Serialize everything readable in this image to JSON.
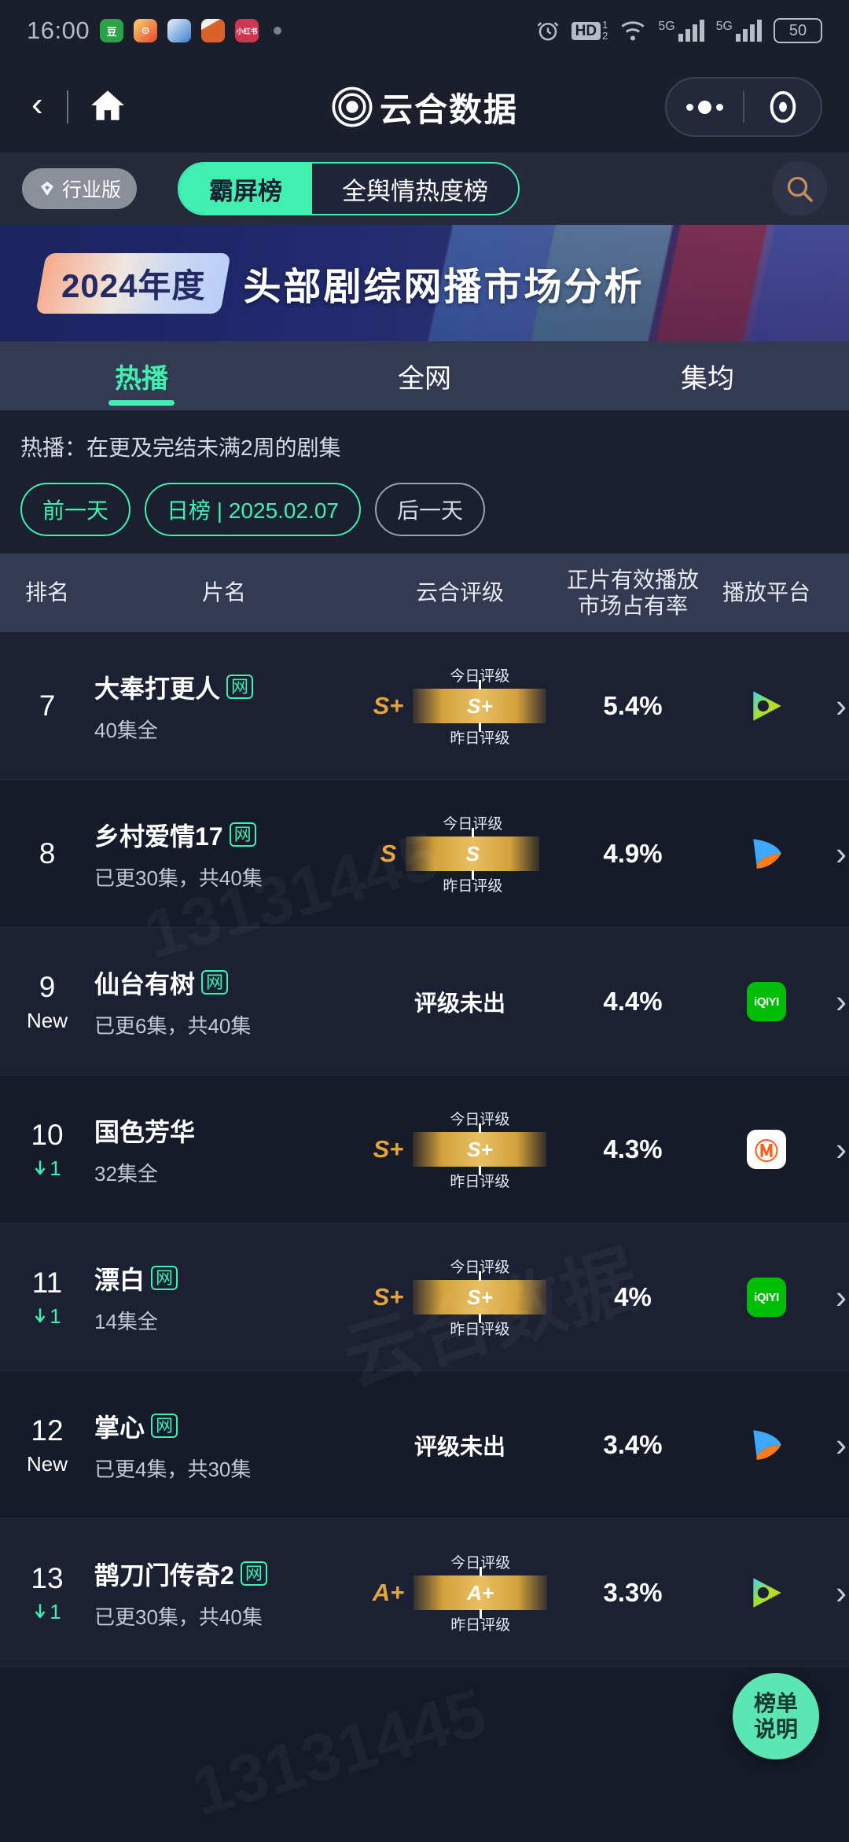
{
  "status_bar": {
    "time": "16:00",
    "app_icons": [
      "douban-icon",
      "weibo-icon",
      "browser-icon",
      "taobao-icon",
      "xiaohongshu-icon"
    ],
    "alarm_icon": "alarm-icon",
    "hd_label": "HD",
    "hd_sub_top": "1",
    "hd_sub_bottom": "2",
    "wifi_icon": "wifi-icon",
    "signal_1_label": "5G",
    "signal_2_label": "5G",
    "battery": "50"
  },
  "nav": {
    "back_icon": "back-chevron-icon",
    "home_icon": "home-icon",
    "logo_icon": "yunhe-logo-icon",
    "title": "云合数据",
    "more_icon": "more-dots-icon",
    "close_icon": "close-target-icon"
  },
  "toggle_bar": {
    "industry_badge": "行业版",
    "badge_icon": "diamond-icon",
    "segments": [
      {
        "label": "霸屏榜",
        "active": true
      },
      {
        "label": "全舆情热度榜",
        "active": false
      }
    ],
    "search_icon": "search-icon"
  },
  "banner": {
    "year_tag": "2024年度",
    "title": "头部剧综网播市场分析"
  },
  "tabs": [
    {
      "label": "热播",
      "active": true
    },
    {
      "label": "全网",
      "active": false
    },
    {
      "label": "集均",
      "active": false
    }
  ],
  "filters": {
    "note": "热播：在更及完结未满2周的剧集",
    "prev_day": "前一天",
    "date_chip": "日榜 | 2025.02.07",
    "next_day": "后一天"
  },
  "table": {
    "headers": {
      "rank": "排名",
      "name": "片名",
      "grade": "云合评级",
      "share_line1": "正片有效播放",
      "share_line2": "市场占有率",
      "platform": "播放平台"
    },
    "grade_labels": {
      "today": "今日评级",
      "yesterday": "昨日评级",
      "none": "评级未出"
    },
    "rows": [
      {
        "rank": "7",
        "rank_sub": "",
        "rank_change": "",
        "title": "大奉打更人",
        "net_tag": "网",
        "episodes": "40集全",
        "grade_letter": "S+",
        "grade_bar": "S+",
        "grade_status": "",
        "share": "5.4%",
        "platform": "youku",
        "arrow_icon": "chevron-right-icon"
      },
      {
        "rank": "8",
        "rank_sub": "",
        "rank_change": "",
        "title": "乡村爱情17",
        "net_tag": "网",
        "episodes": "已更30集，共40集",
        "grade_letter": "S",
        "grade_bar": "S",
        "grade_status": "",
        "share": "4.9%",
        "platform": "tencent",
        "arrow_icon": "chevron-right-icon"
      },
      {
        "rank": "9",
        "rank_sub": "New",
        "rank_change": "",
        "title": "仙台有树",
        "net_tag": "网",
        "episodes": "已更6集，共40集",
        "grade_letter": "",
        "grade_bar": "",
        "grade_status": "评级未出",
        "share": "4.4%",
        "platform": "iqiyi",
        "arrow_icon": "chevron-right-icon"
      },
      {
        "rank": "10",
        "rank_sub": "",
        "rank_change": "1",
        "title": "国色芳华",
        "net_tag": "",
        "episodes": "32集全",
        "grade_letter": "S+",
        "grade_bar": "S+",
        "grade_status": "",
        "share": "4.3%",
        "platform": "mango",
        "arrow_icon": "chevron-right-icon"
      },
      {
        "rank": "11",
        "rank_sub": "",
        "rank_change": "1",
        "title": "漂白",
        "net_tag": "网",
        "episodes": "14集全",
        "grade_letter": "S+",
        "grade_bar": "S+",
        "grade_status": "",
        "share": "4%",
        "platform": "iqiyi",
        "arrow_icon": "chevron-right-icon"
      },
      {
        "rank": "12",
        "rank_sub": "New",
        "rank_change": "",
        "title": "掌心",
        "net_tag": "网",
        "episodes": "已更4集，共30集",
        "grade_letter": "",
        "grade_bar": "",
        "grade_status": "评级未出",
        "share": "3.4%",
        "platform": "tencent",
        "arrow_icon": "chevron-right-icon"
      },
      {
        "rank": "13",
        "rank_sub": "",
        "rank_change": "1",
        "title": "鹊刀门传奇2",
        "net_tag": "网",
        "episodes": "已更30集，共40集",
        "grade_letter": "A+",
        "grade_bar": "A+",
        "grade_status": "",
        "share": "3.3%",
        "platform": "youku",
        "arrow_icon": "chevron-right-icon"
      }
    ]
  },
  "fab": {
    "line1": "榜单",
    "line2": "说明"
  },
  "watermarks": [
    "13131445",
    "云合数据",
    "13131445"
  ],
  "colors": {
    "accent": "#3ff0b0",
    "gold": "#d3a13a",
    "banner_blue": "#1a2460",
    "header_bg": "#343a52"
  }
}
